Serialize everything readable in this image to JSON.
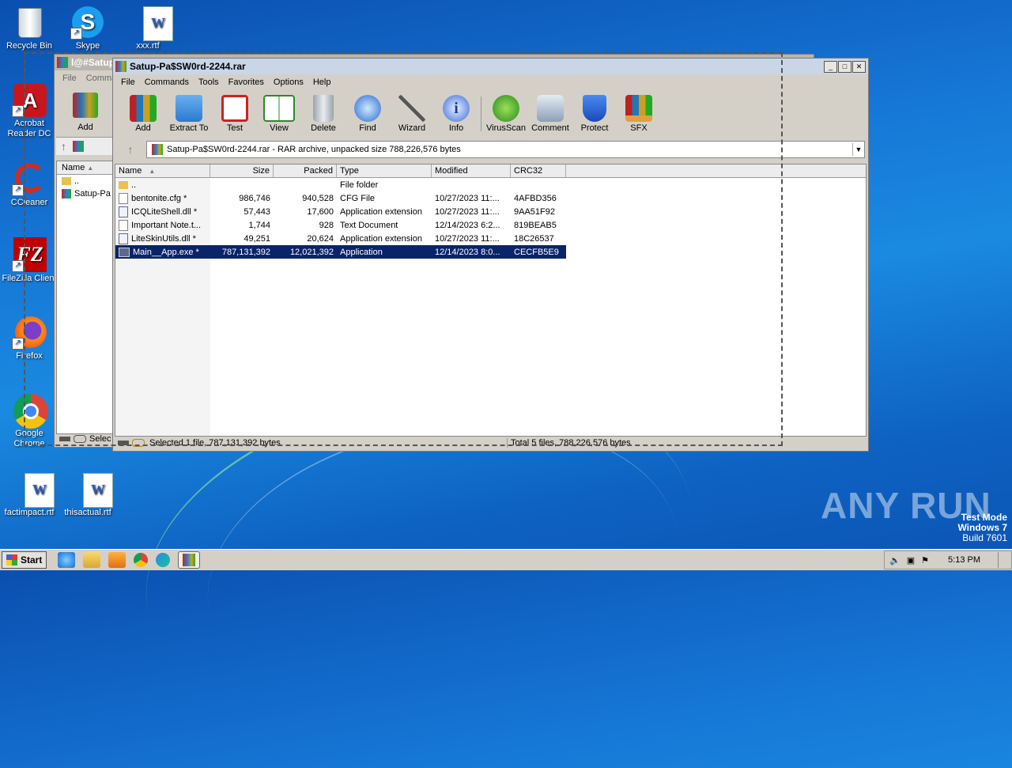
{
  "desktop": {
    "icons": [
      {
        "label": "Recycle Bin"
      },
      {
        "label": "Skype"
      },
      {
        "label": "xxx.rtf"
      },
      {
        "label": "Acrobat Reader DC"
      },
      {
        "label": "CCleaner"
      },
      {
        "label": "FileZilla Client"
      },
      {
        "label": "Firefox"
      },
      {
        "label": "Google Chrome"
      },
      {
        "label": "factimpact.rtf"
      },
      {
        "label": "thisactual.rtf"
      }
    ]
  },
  "back_window": {
    "title": "l@#Satup",
    "menu": [
      "File",
      "Comma"
    ],
    "add_label": "Add",
    "col_name": "Name",
    "items": [
      "..",
      "Satup-Pa"
    ],
    "status": "Selec"
  },
  "main_window": {
    "title": "Satup-Pa$SW0rd-2244.rar",
    "menu": [
      "File",
      "Commands",
      "Tools",
      "Favorites",
      "Options",
      "Help"
    ],
    "toolbar": [
      "Add",
      "Extract To",
      "Test",
      "View",
      "Delete",
      "Find",
      "Wizard",
      "Info",
      "VirusScan",
      "Comment",
      "Protect",
      "SFX"
    ],
    "path": "Satup-Pa$SW0rd-2244.rar - RAR archive, unpacked size 788,226,576 bytes",
    "columns": [
      "Name",
      "Size",
      "Packed",
      "Type",
      "Modified",
      "CRC32"
    ],
    "rows": [
      {
        "name": "..",
        "size": "",
        "packed": "",
        "type": "File folder",
        "modified": "",
        "crc": ""
      },
      {
        "name": "bentonite.cfg *",
        "size": "986,746",
        "packed": "940,528",
        "type": "CFG File",
        "modified": "10/27/2023 11:...",
        "crc": "4AFBD356"
      },
      {
        "name": "ICQLiteShell.dll *",
        "size": "57,443",
        "packed": "17,600",
        "type": "Application extension",
        "modified": "10/27/2023 11:...",
        "crc": "9AA51F92"
      },
      {
        "name": "Important Note.t...",
        "size": "1,744",
        "packed": "928",
        "type": "Text Document",
        "modified": "12/14/2023 6:2...",
        "crc": "819BEAB5"
      },
      {
        "name": "LiteSkinUtils.dll *",
        "size": "49,251",
        "packed": "20,624",
        "type": "Application extension",
        "modified": "10/27/2023 11:...",
        "crc": "18C26537"
      },
      {
        "name": "Main__App.exe *",
        "size": "787,131,392",
        "packed": "12,021,392",
        "type": "Application",
        "modified": "12/14/2023 8:0...",
        "crc": "CECFB5E9"
      }
    ],
    "status_left": "Selected 1 file, 787,131,392 bytes",
    "status_right": "Total 5 files, 788,226,576 bytes"
  },
  "taskbar": {
    "start": "Start",
    "clock": "5:13 PM"
  },
  "watermark": {
    "brand": "ANY RUN",
    "line1": "Test Mode",
    "line2": "Windows 7",
    "line3": "Build 7601"
  }
}
